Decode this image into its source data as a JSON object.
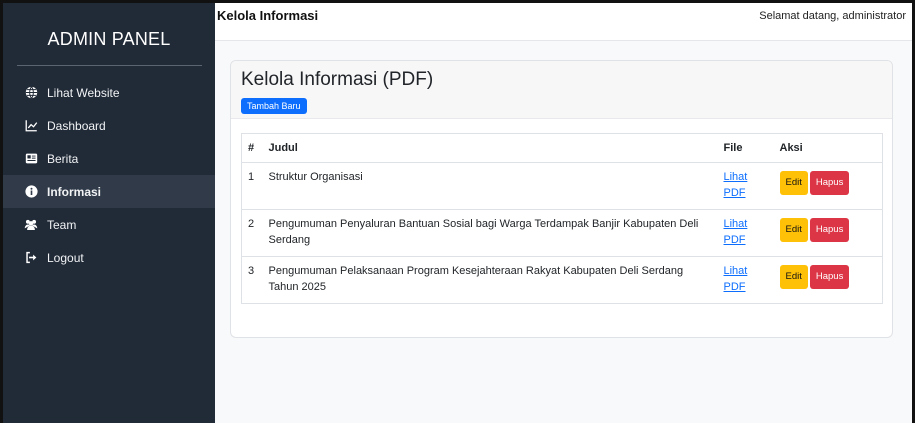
{
  "sidebar": {
    "brand": "ADMIN PANEL",
    "items": [
      {
        "label": "Lihat Website",
        "icon": "globe-icon"
      },
      {
        "label": "Dashboard",
        "icon": "chart-line-icon"
      },
      {
        "label": "Berita",
        "icon": "newspaper-icon"
      },
      {
        "label": "Informasi",
        "icon": "info-circle-icon",
        "active": true
      },
      {
        "label": "Team",
        "icon": "users-icon"
      },
      {
        "label": "Logout",
        "icon": "sign-out-icon"
      }
    ]
  },
  "topbar": {
    "title": "Kelola Informasi",
    "welcome": "Selamat datang, administrator"
  },
  "card": {
    "title": "Kelola Informasi (PDF)",
    "add_button": "Tambah Baru"
  },
  "table": {
    "headers": [
      "#",
      "Judul",
      "File",
      "Aksi"
    ],
    "rows": [
      {
        "no": "1",
        "judul": "Struktur Organisasi",
        "file": "Lihat PDF",
        "edit": "Edit",
        "hapus": "Hapus"
      },
      {
        "no": "2",
        "judul": "Pengumuman Penyaluran Bantuan Sosial bagi Warga Terdampak Banjir Kabupaten Deli Serdang",
        "file": "Lihat PDF",
        "edit": "Edit",
        "hapus": "Hapus"
      },
      {
        "no": "3",
        "judul": "Pengumuman Pelaksanaan Program Kesejahteraan Rakyat Kabupaten Deli Serdang Tahun 2025",
        "file": "Lihat PDF",
        "edit": "Edit",
        "hapus": "Hapus"
      }
    ]
  },
  "colors": {
    "sidebar_bg": "#212a37",
    "active_bg": "#303a48",
    "primary": "#0d6efd",
    "warning": "#ffc107",
    "danger": "#dc3545"
  }
}
